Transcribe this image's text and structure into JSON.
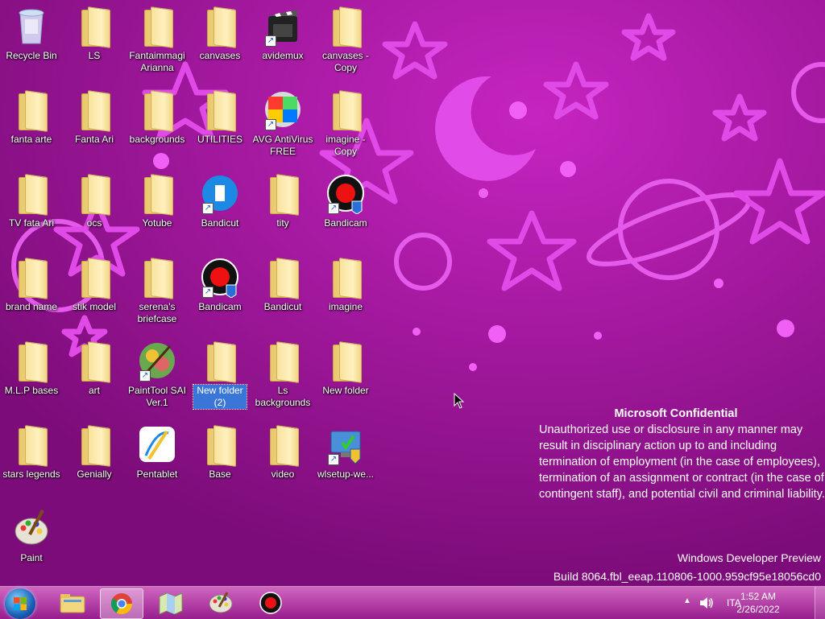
{
  "desktop": {
    "icons": [
      {
        "label": "Recycle Bin",
        "type": "recycle"
      },
      {
        "label": "LS",
        "type": "folder"
      },
      {
        "label": "Fantaimmagi Arianna",
        "type": "folder"
      },
      {
        "label": "canvases",
        "type": "folder"
      },
      {
        "label": "avidemux",
        "type": "app-avidemux"
      },
      {
        "label": "canvases - Copy",
        "type": "folder"
      },
      {
        "label": "fanta arte",
        "type": "folder"
      },
      {
        "label": "Fanta Ari",
        "type": "folder"
      },
      {
        "label": "backgrounds",
        "type": "folder"
      },
      {
        "label": "UTILITIES",
        "type": "folder"
      },
      {
        "label": "AVG AntiVirus FREE",
        "type": "app-avg"
      },
      {
        "label": "imagine - Copy",
        "type": "folder"
      },
      {
        "label": "TV  fata Ari",
        "type": "folder"
      },
      {
        "label": "ocs",
        "type": "folder"
      },
      {
        "label": "Yotube",
        "type": "folder"
      },
      {
        "label": "Bandicut",
        "type": "app-bandicut"
      },
      {
        "label": "tity",
        "type": "folder"
      },
      {
        "label": "Bandicam",
        "type": "app-bandicam"
      },
      {
        "label": "brand name",
        "type": "folder"
      },
      {
        "label": "stik  model",
        "type": "folder"
      },
      {
        "label": "serena's briefcase",
        "type": "folder"
      },
      {
        "label": "Bandicam",
        "type": "app-bandicam"
      },
      {
        "label": "Bandicut",
        "type": "folder"
      },
      {
        "label": "imagine",
        "type": "folder"
      },
      {
        "label": "M.L.P bases",
        "type": "folder"
      },
      {
        "label": "art",
        "type": "folder"
      },
      {
        "label": "PaintTool SAI Ver.1",
        "type": "app-sai"
      },
      {
        "label": "New folder (2)",
        "type": "folder",
        "selected": true
      },
      {
        "label": "Ls backgrounds",
        "type": "folder"
      },
      {
        "label": "New folder",
        "type": "folder"
      },
      {
        "label": "stars legends",
        "type": "folder"
      },
      {
        "label": "Genially",
        "type": "folder"
      },
      {
        "label": "Pentablet",
        "type": "app-pentablet"
      },
      {
        "label": "Base",
        "type": "folder"
      },
      {
        "label": "video",
        "type": "folder"
      },
      {
        "label": "wlsetup-we...",
        "type": "app-setup"
      },
      {
        "label": "Paint",
        "type": "app-paint"
      }
    ]
  },
  "watermark": {
    "title": "Microsoft Confidential",
    "body": "Unauthorized use or disclosure in any manner may result in disciplinary action up to and including termination of employment (in the case of employees), termination of an assignment or contract (in the case of contingent staff), and potential civil and criminal liability.",
    "edition": "Windows Developer Preview",
    "build": "Build 8064.fbl_eeap.110806-1000.959cf95e18056cd0"
  },
  "taskbar": {
    "pinned": [
      {
        "name": "explorer",
        "icon": "folder-icon"
      },
      {
        "name": "chrome",
        "icon": "chrome-icon",
        "active": true
      },
      {
        "name": "maps",
        "icon": "map-icon"
      },
      {
        "name": "paint",
        "icon": "paint-palette-icon"
      },
      {
        "name": "bandicam",
        "icon": "record-icon"
      }
    ],
    "language": "ITA",
    "time": "1:52 AM",
    "date": "2/26/2022"
  },
  "colors": {
    "wallpaper": "#a3149c",
    "stars": "#e040e6",
    "selection": "#3a76d8"
  }
}
